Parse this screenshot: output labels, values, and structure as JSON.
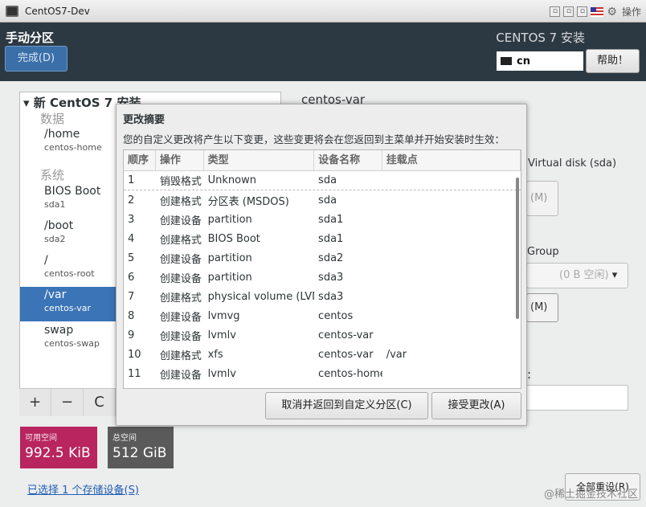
{
  "window": {
    "title": "CentOS7-Dev",
    "operations_label": "操作"
  },
  "header": {
    "page_title": "手动分区",
    "product_title": "CENTOS 7 安装",
    "done_button": "完成(D)",
    "keyboard_layout": "cn",
    "help_button": "帮助！"
  },
  "left_panel": {
    "section_title": "新 CentOS 7 安装",
    "category_data": "数据",
    "category_system": "系统",
    "items": [
      {
        "name": "/home",
        "sub": "centos-home"
      },
      {
        "name": "BIOS Boot",
        "sub": "sda1"
      },
      {
        "name": "/boot",
        "sub": "sda2"
      },
      {
        "name": "/",
        "sub": "centos-root"
      },
      {
        "name": "/var",
        "sub": "centos-var"
      },
      {
        "name": "swap",
        "sub": "centos-swap"
      }
    ],
    "toolbar": {
      "add": "+",
      "remove": "−",
      "refresh": "C"
    }
  },
  "storage": {
    "available_label": "可用空间",
    "available_value": "992.5 KiB",
    "total_label": "总空间",
    "total_value": "512 GiB",
    "selected_devices_link": "已选择 1 个存储设备(S)"
  },
  "right_panel": {
    "title": "centos-var",
    "disk_label": "Virtual disk (sda)",
    "modify_btn1": "(M)",
    "volume_group_label": "Group",
    "volume_group_combo": "(0 B 空闲)",
    "modify_btn2": "(M)",
    "colon": ":",
    "reset_button": "全部重设(R)"
  },
  "dialog": {
    "title": "更改摘要",
    "description": "您的自定义更改将产生以下变更，这些变更将会在您返回到主菜单并开始安装时生效：",
    "columns": [
      "顺序",
      "操作",
      "类型",
      "设备名称",
      "挂载点"
    ],
    "rows": [
      [
        "1",
        "销毁格式",
        "Unknown",
        "sda",
        ""
      ],
      [
        "2",
        "创建格式",
        "分区表 (MSDOS)",
        "sda",
        ""
      ],
      [
        "3",
        "创建设备",
        "partition",
        "sda1",
        ""
      ],
      [
        "4",
        "创建格式",
        "BIOS Boot",
        "sda1",
        ""
      ],
      [
        "5",
        "创建设备",
        "partition",
        "sda2",
        ""
      ],
      [
        "6",
        "创建设备",
        "partition",
        "sda3",
        ""
      ],
      [
        "7",
        "创建格式",
        "physical volume (LVM)",
        "sda3",
        ""
      ],
      [
        "8",
        "创建设备",
        "lvmvg",
        "centos",
        ""
      ],
      [
        "9",
        "创建设备",
        "lvmlv",
        "centos-var",
        ""
      ],
      [
        "10",
        "创建格式",
        "xfs",
        "centos-var",
        "/var"
      ],
      [
        "11",
        "创建设备",
        "lvmlv",
        "centos-home",
        ""
      ]
    ],
    "cancel_button": "取消并返回到自定义分区(C)",
    "accept_button": "接受更改(A)"
  },
  "watermark": "@稀土掘金技术社区",
  "colors": {
    "destroy": "#cc0000",
    "create": "#2b8a1c",
    "header_bg": "#2d3942",
    "available_bg": "#b8255f"
  }
}
